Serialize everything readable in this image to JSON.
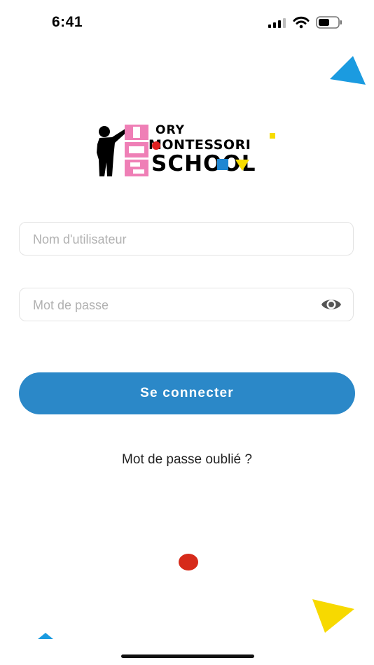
{
  "status_bar": {
    "time": "6:41"
  },
  "logo": {
    "line1": "ORY",
    "line2": "MONTESSORI",
    "line3": "SCHOOL",
    "colors": {
      "pink": "#ef7fb6",
      "red": "#e02020",
      "yellow": "#f7dc00",
      "blue": "#1e86d2"
    }
  },
  "login_form": {
    "username_placeholder": "Nom d'utilisateur",
    "password_placeholder": "Mot de passe",
    "submit_label": "Se connecter",
    "forgot_password": "Mot de passe oublié ?"
  },
  "theme": {
    "primary": "#2b88c8",
    "deco_blue": "#1b9be0",
    "deco_yellow": "#f7d900",
    "deco_red": "#d62a1a"
  }
}
